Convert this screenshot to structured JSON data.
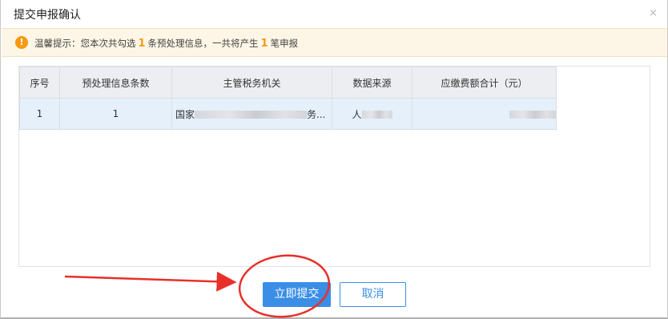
{
  "dialog": {
    "title": "提交申报确认",
    "close_glyph": "×"
  },
  "notice": {
    "icon_glyph": "!",
    "prefix": "温馨提示：您本次共勾选",
    "selected_count": "1",
    "middle": "条预处理信息，一共将产生",
    "filing_count": "1",
    "suffix": "笔申报"
  },
  "table": {
    "headers": [
      "序号",
      "预处理信息条数",
      "主管税务机关",
      "数据来源",
      "应缴费额合计（元）"
    ],
    "rows": [
      {
        "index": "1",
        "count": "1",
        "authority_start": "国家",
        "authority_end": "务...",
        "source_start": "人"
      }
    ]
  },
  "buttons": {
    "submit": "立即提交",
    "cancel": "取消"
  },
  "colors": {
    "primary": "#3a8ee6",
    "warning": "#f59a12",
    "annotation_red": "#e8302a"
  }
}
